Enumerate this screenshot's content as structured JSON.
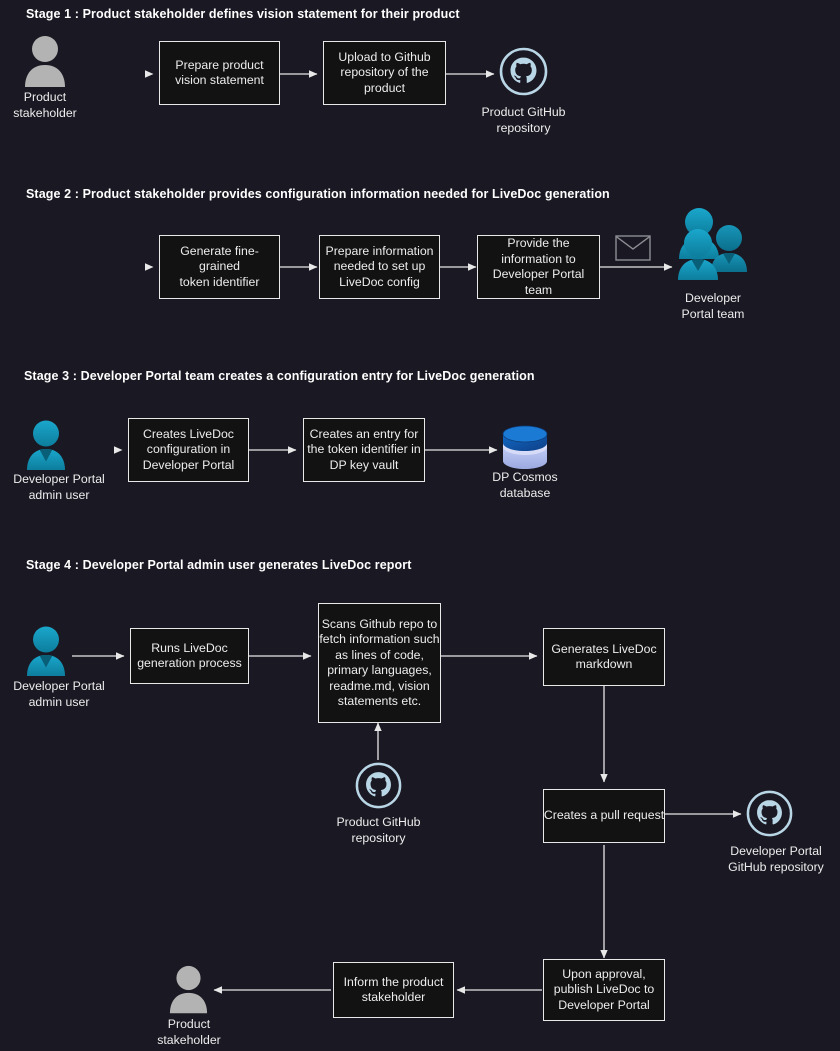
{
  "diagram": {
    "title": "LiveDoc generation process flow",
    "background_color": "#1a1822",
    "box_fill_color": "#121212",
    "box_border_color": "#e8e8e8",
    "arrow_color": "#e8e8e8",
    "accent_teal": "#1391b5",
    "accent_grey": "#b3b3b3",
    "github_color": "#b9d6e6",
    "database_color": "#c3cdf0"
  },
  "stages": [
    {
      "id": "stage-1",
      "title": "Stage 1 : Product stakeholder defines vision statement for their product",
      "actor": {
        "name": "Product\nstakeholder",
        "icon": "person-grey-icon"
      },
      "steps": [
        {
          "label": "Prepare product\nvision statement"
        },
        {
          "label": "Upload to Github\nrepository of the\nproduct"
        }
      ],
      "target": {
        "name": "Product GitHub\nrepository",
        "icon": "github-icon"
      }
    },
    {
      "id": "stage-2",
      "title": "Stage 2 : Product stakeholder provides configuration information needed for LiveDoc generation",
      "steps": [
        {
          "label": "Generate fine-grained\ntoken identifier"
        },
        {
          "label": "Prepare information\nneeded to set up\nLiveDoc config"
        },
        {
          "label": "Provide the\ninformation to\nDeveloper Portal\nteam"
        }
      ],
      "mail": {
        "icon": "envelope-icon"
      },
      "target": {
        "name": "Developer\nPortal team",
        "icon": "people-group-teal-icon"
      }
    },
    {
      "id": "stage-3",
      "title": "Stage 3 : Developer Portal team creates a configuration entry for LiveDoc generation",
      "actor": {
        "name": "Developer Portal\nadmin user",
        "icon": "person-teal-icon"
      },
      "steps": [
        {
          "label": "Creates LiveDoc\nconfiguration in\nDeveloper Portal"
        },
        {
          "label": "Creates an entry for\nthe token identifier in\nDP key vault"
        }
      ],
      "target": {
        "name": "DP Cosmos\ndatabase",
        "icon": "database-icon"
      }
    },
    {
      "id": "stage-4",
      "title": "Stage 4 : Developer Portal admin user generates LiveDoc report",
      "actor": {
        "name": "Developer Portal\nadmin user",
        "icon": "person-teal-icon"
      },
      "steps": [
        {
          "label": "Runs LiveDoc\ngeneration process"
        },
        {
          "label": "Scans Github repo to\nfetch information such\nas lines of code,\nprimary languages,\nreadme.md, vision\nstatements etc."
        },
        {
          "label": "Generates LiveDoc\nmarkdown"
        },
        {
          "label": "Creates a pull request"
        },
        {
          "label": "Upon approval,\npublish LiveDoc to\nDeveloper Portal"
        },
        {
          "label": "Inform the product\nstakeholder"
        }
      ],
      "source_repo": {
        "name": "Product GitHub\nrepository",
        "icon": "github-icon"
      },
      "pr_target": {
        "name": "Developer Portal\nGitHub repository",
        "icon": "github-icon"
      },
      "final_actor": {
        "name": "Product\nstakeholder",
        "icon": "person-grey-icon"
      }
    }
  ]
}
